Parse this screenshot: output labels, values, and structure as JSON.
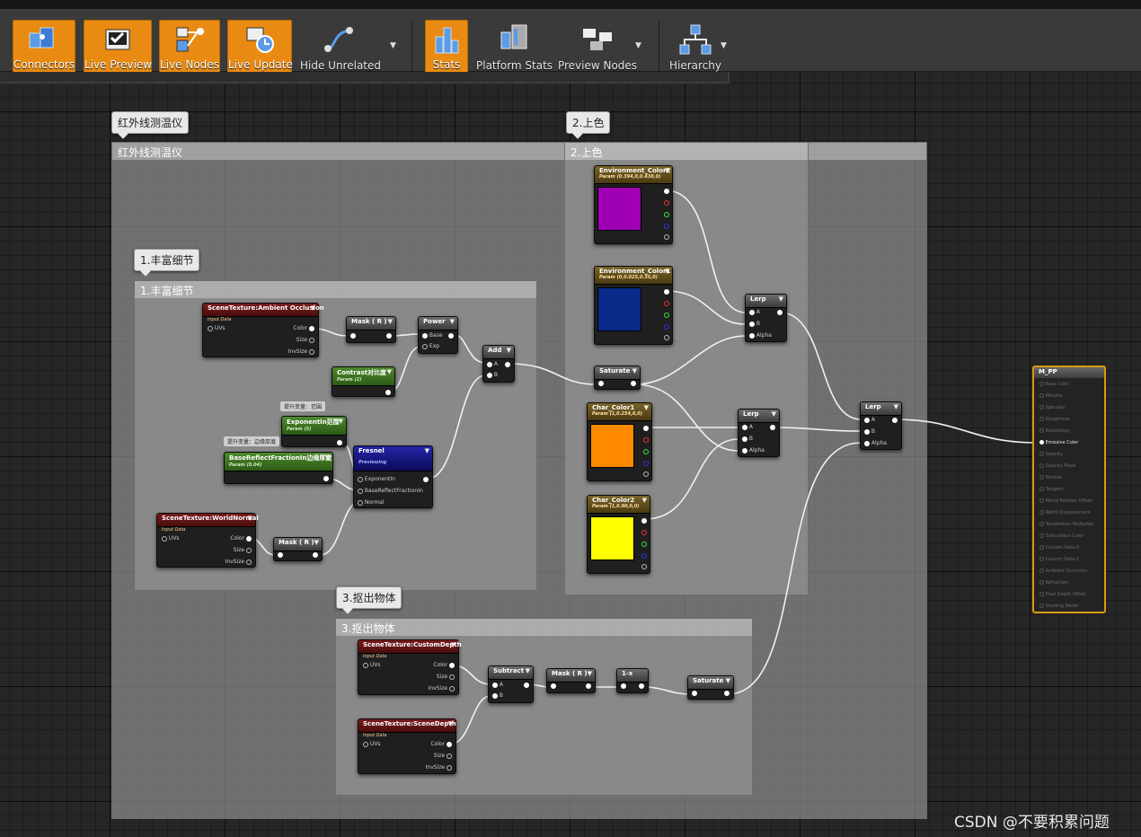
{
  "toolbar": {
    "buttons": [
      {
        "label": "Connectors",
        "active": true,
        "icon": "connectors-icon"
      },
      {
        "label": "Live Preview",
        "active": true,
        "icon": "live-preview-icon"
      },
      {
        "label": "Live Nodes",
        "active": true,
        "icon": "live-nodes-icon"
      },
      {
        "label": "Live Update",
        "active": true,
        "icon": "live-update-icon"
      },
      {
        "label": "Hide Unrelated",
        "active": false,
        "icon": "hide-unrelated-icon"
      },
      {
        "label": "Stats",
        "active": true,
        "icon": "stats-icon"
      },
      {
        "label": "Platform Stats",
        "active": false,
        "icon": "platform-stats-icon"
      },
      {
        "label": "Preview Nodes",
        "active": false,
        "icon": "preview-nodes-icon"
      },
      {
        "label": "Hierarchy",
        "active": false,
        "icon": "hierarchy-icon"
      }
    ],
    "dropdown_glyph": "▼"
  },
  "comments": {
    "infrared": {
      "bubble": "红外线测温仪",
      "title": "红外线测温仪"
    },
    "color": {
      "bubble": "2.上色",
      "title": "2.上色"
    },
    "detail": {
      "bubble": "1.丰富细节",
      "title": "1.丰富细节"
    },
    "cutout": {
      "bubble": "3.抠出物体",
      "title": "3.抠出物体"
    }
  },
  "nodes": {
    "ao": {
      "title": "SceneTexture:Ambient Occlusion",
      "subtitle": "Input Data",
      "in": "UVs",
      "outs": [
        "Color",
        "Size",
        "InvSize"
      ]
    },
    "mask1": {
      "title": "Mask ( R )"
    },
    "power": {
      "title": "Power",
      "pins": [
        "Base",
        "Exp"
      ]
    },
    "add": {
      "title": "Add",
      "pins": [
        "A",
        "B"
      ]
    },
    "contrast": {
      "title": "Contrast对比度",
      "subtitle": "Param (2)"
    },
    "exponent": {
      "title": "Exponentln范围",
      "subtitle": "Param (5)",
      "tag": "提升变量：范围"
    },
    "brf": {
      "title": "BaseReflectFractionIn边缘厚度",
      "subtitle": "Param (0.04)",
      "tag": "提升变量：边缘厚度"
    },
    "fresnel": {
      "title": "Fresnel",
      "subtitle": "Previewing",
      "pins": [
        "ExponentIn",
        "BaseReflectFractionIn",
        "Normal"
      ]
    },
    "wn": {
      "title": "SceneTexture:WorldNormal",
      "subtitle": "Input Data",
      "in": "UVs",
      "outs": [
        "Color",
        "Size",
        "InvSize"
      ]
    },
    "mask2": {
      "title": "Mask ( R )"
    },
    "env2": {
      "title": "Environment_Color2",
      "subtitle": "Param (0.394,0,0.438,0)",
      "color": "#a000b4"
    },
    "env1": {
      "title": "Environment_Color1",
      "subtitle": "Param (0,0.025,0.35,0)",
      "color": "#0a2a8a"
    },
    "lerp1": {
      "title": "Lerp",
      "pins": [
        "A",
        "B",
        "Alpha"
      ]
    },
    "saturate1": {
      "title": "Saturate"
    },
    "char1": {
      "title": "Char_Color1",
      "subtitle": "Param (1,0.254,0,0)",
      "color": "#ff8a00"
    },
    "char2": {
      "title": "Char_Color2",
      "subtitle": "Param (1,0.90,0,0)",
      "color": "#ffff00"
    },
    "lerp2": {
      "title": "Lerp",
      "pins": [
        "A",
        "B",
        "Alpha"
      ]
    },
    "lerp3": {
      "title": "Lerp",
      "pins": [
        "A",
        "B",
        "Alpha"
      ]
    },
    "cd": {
      "title": "SceneTexture:CustomDepth",
      "subtitle": "Input Data",
      "in": "UVs",
      "outs": [
        "Color",
        "Size",
        "InvSize"
      ]
    },
    "sd": {
      "title": "SceneTexture:SceneDepth",
      "subtitle": "Input Data",
      "in": "UVs",
      "outs": [
        "Color",
        "Size",
        "InvSize"
      ]
    },
    "subtract": {
      "title": "Subtract",
      "pins": [
        "A",
        "B"
      ]
    },
    "mask3": {
      "title": "Mask ( R )"
    },
    "oneminus": {
      "title": "1-x"
    },
    "saturate2": {
      "title": "Saturate"
    }
  },
  "material": {
    "title": "M_PP",
    "inputs": [
      "Base Color",
      "Metallic",
      "Specular",
      "Roughness",
      "Anisotropy",
      "Emissive Color",
      "Opacity",
      "Opacity Mask",
      "Normal",
      "Tangent",
      "World Position Offset",
      "World Displacement",
      "Tessellation Multiplier",
      "Subsurface Color",
      "Custom Data 0",
      "Custom Data 1",
      "Ambient Occlusion",
      "Refraction",
      "Pixel Depth Offset",
      "Shading Model"
    ],
    "active_input": "Emissive Color"
  },
  "watermark": "CSDN @不要积累问题"
}
